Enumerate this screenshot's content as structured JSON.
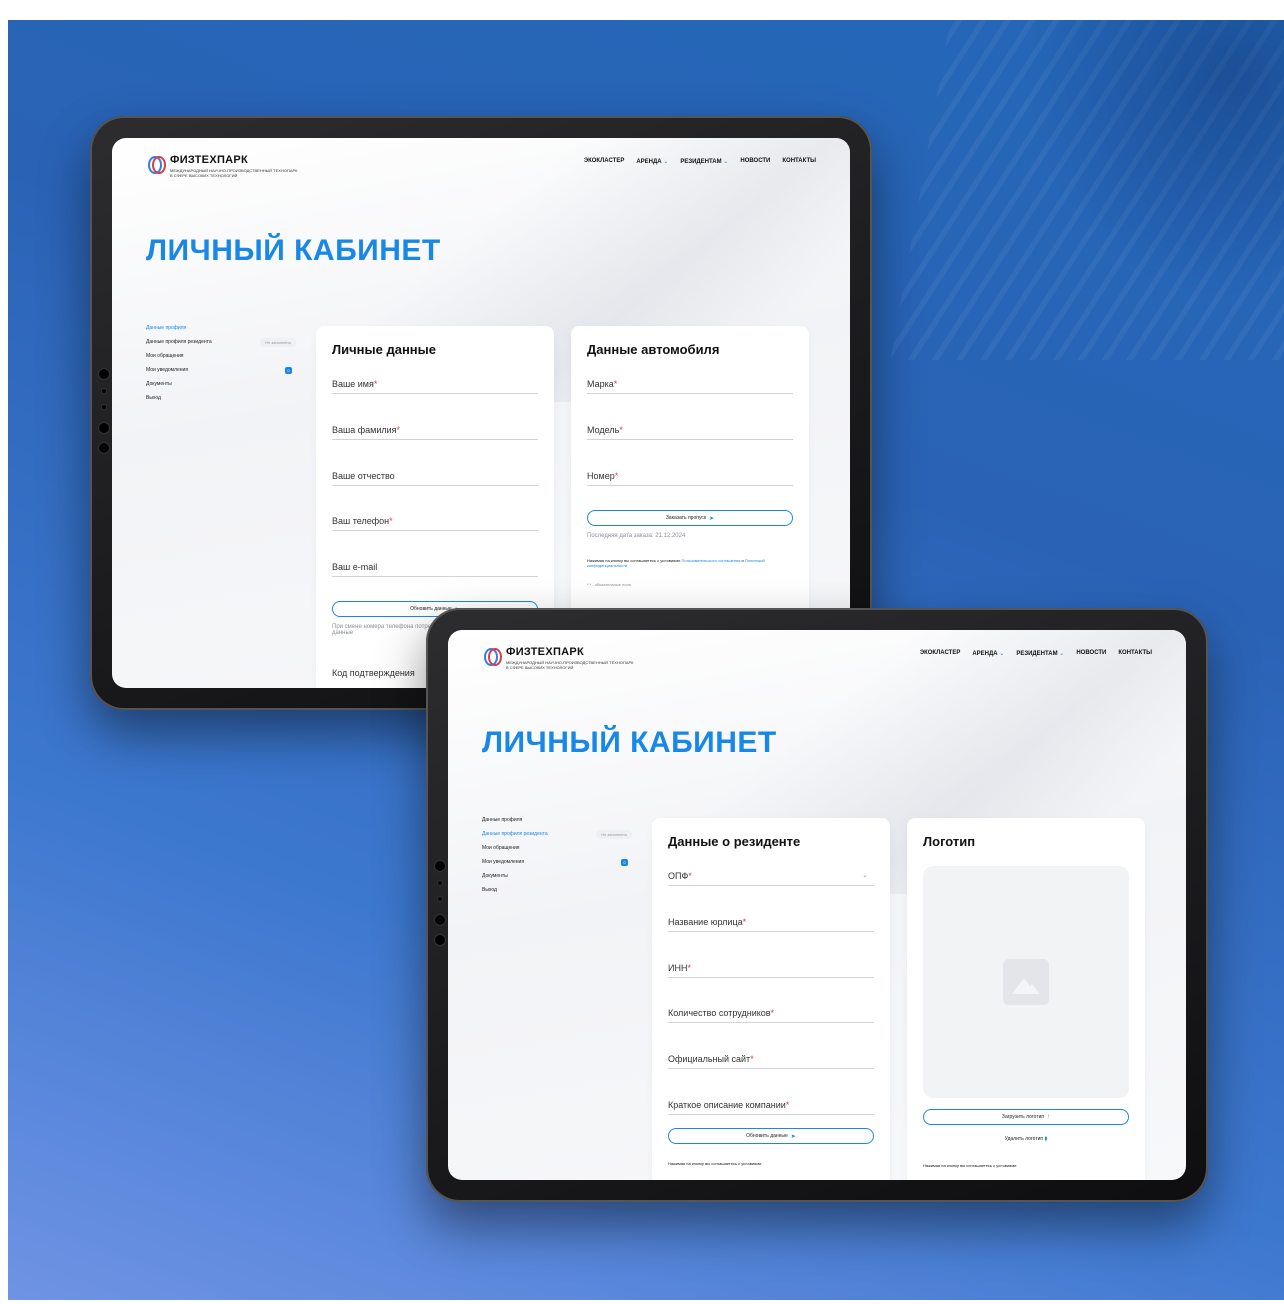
{
  "header": {
    "logo_name": "ФИЗТЕХПАРК",
    "logo_tagline": "МЕЖДУНАРОДНЫЙ НАУЧНО-ПРОИЗВОДСТВЕННЫЙ ТЕХНОПАРК В СФЕРЕ ВЫСОКИХ ТЕХНОЛОГИЙ",
    "nav": [
      "ЭКОКЛАСТЕР",
      "АРЕНДА",
      "РЕЗИДЕНТАМ",
      "НОВОСТИ",
      "КОНТАКТЫ"
    ]
  },
  "page_title": "ЛИЧНЫЙ КАБИНЕТ",
  "sidebar": {
    "items": [
      "Данные профиля",
      "Данные профиля резидента",
      "Мои обращения",
      "Мои уведомления",
      "Документы",
      "Выход"
    ],
    "badge": "Не заполнено",
    "notif_count": "0"
  },
  "tablet1": {
    "personal": {
      "title": "Личные данные",
      "fields": [
        "Ваше имя",
        "Ваша фамилия",
        "Ваше отчество",
        "Ваш телефон",
        "Ваш e-mail"
      ],
      "button": "Обновить данные",
      "phone_note": "При смене номера телефона потребуется подтвердить введённые данные",
      "code_label": "Код подтверждения"
    },
    "car": {
      "title": "Данные автомобиля",
      "fields": [
        "Марка",
        "Модель",
        "Номер"
      ],
      "button": "Заказать пропуск",
      "last_order": "Последняя дата заказа: 21.12.2024",
      "consent_1": "Нажимая на кнопку вы соглашаетесь с условиями",
      "consent_link_1": "Пользовательского соглашения",
      "consent_and": " и ",
      "consent_link_2": "Политикой конфиденциальности",
      "required_note": "* - обязательные поля"
    }
  },
  "tablet2": {
    "resident": {
      "title": "Данные о резиденте",
      "fields": [
        "ОПФ",
        "Название юрлица",
        "ИНН",
        "Количество сотрудников",
        "Официальный сайт",
        "Краткое описание компании"
      ],
      "button": "Обновить данные",
      "consent": "Нажимая на кнопку вы соглашаетесь с условиями"
    },
    "logo": {
      "title": "Логотип",
      "upload": "Загрузить логотип",
      "delete": "Удалить логотип",
      "consent": "Нажимая на кнопку вы соглашаетесь с условиями"
    }
  },
  "colors": {
    "accent": "#1987e8",
    "required": "#e03a4a",
    "background": "#2a63b6"
  }
}
